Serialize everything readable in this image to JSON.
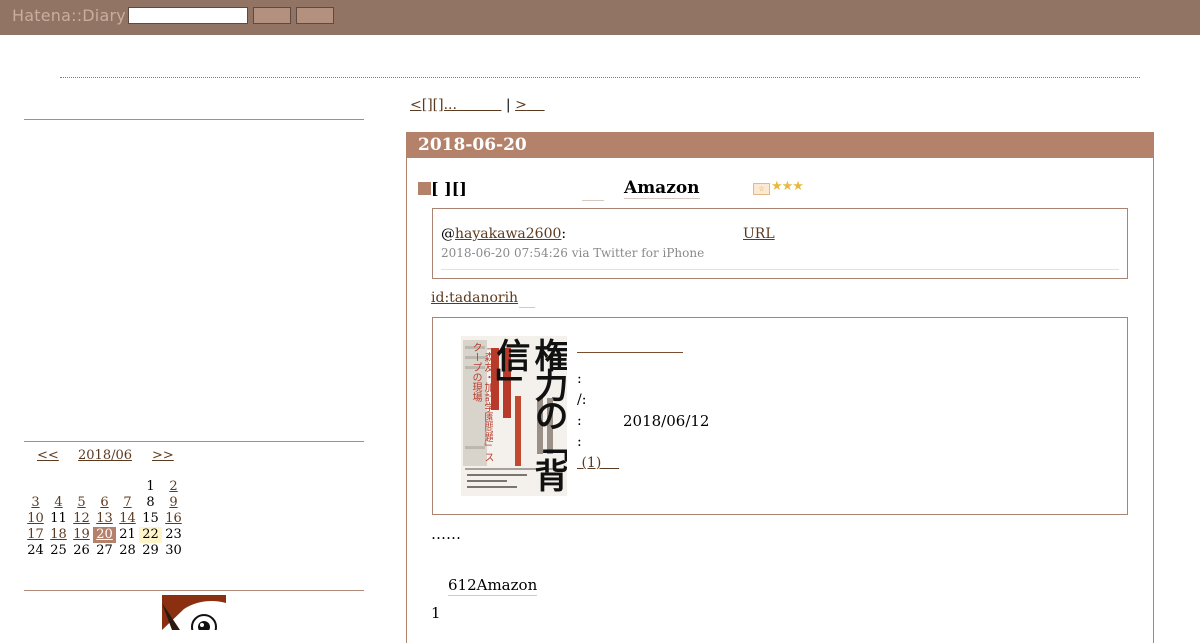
{
  "header": {
    "logo": "Hatena::Diary",
    "search_placeholder": "",
    "button1_label": "",
    "button2_label": ""
  },
  "pager": {
    "prev": "<[][]...",
    "separator": "|",
    "next": ">"
  },
  "calendar": {
    "prev": "<<",
    "month": "2018/06",
    "next": ">>",
    "weeks": [
      [
        {
          "d": ""
        },
        {
          "d": ""
        },
        {
          "d": ""
        },
        {
          "d": ""
        },
        {
          "d": ""
        },
        {
          "d": "1",
          "link": false
        },
        {
          "d": "2",
          "link": true
        }
      ],
      [
        {
          "d": "3",
          "link": true
        },
        {
          "d": "4",
          "link": true
        },
        {
          "d": "5",
          "link": true
        },
        {
          "d": "6",
          "link": true
        },
        {
          "d": "7",
          "link": true
        },
        {
          "d": "8",
          "link": false
        },
        {
          "d": "9",
          "link": true
        }
      ],
      [
        {
          "d": "10",
          "link": true
        },
        {
          "d": "11",
          "link": false
        },
        {
          "d": "12",
          "link": true
        },
        {
          "d": "13",
          "link": true
        },
        {
          "d": "14",
          "link": true
        },
        {
          "d": "15",
          "link": false
        },
        {
          "d": "16",
          "link": true
        }
      ],
      [
        {
          "d": "17",
          "link": true
        },
        {
          "d": "18",
          "link": true
        },
        {
          "d": "19",
          "link": true
        },
        {
          "d": "20",
          "link": true,
          "today": true
        },
        {
          "d": "21",
          "link": false
        },
        {
          "d": "22",
          "link": false,
          "highlight": true
        },
        {
          "d": "23",
          "link": false
        }
      ],
      [
        {
          "d": "24",
          "link": false
        },
        {
          "d": "25",
          "link": false
        },
        {
          "d": "26",
          "link": false
        },
        {
          "d": "27",
          "link": false
        },
        {
          "d": "28",
          "link": false
        },
        {
          "d": "29",
          "link": false
        },
        {
          "d": "30",
          "link": false
        }
      ]
    ]
  },
  "entry": {
    "date": "2018-06-20",
    "section_title": "[ ][]",
    "amazon_title": "Amazon",
    "tweet": {
      "at": "@",
      "handle": "hayakawa2600",
      "colon": ":",
      "url_label": "URL",
      "meta": "2018-06-20 07:54:26 via Twitter for iPhone"
    },
    "id_link": "id:tadanorih",
    "book": {
      "line1": ":",
      "line2": "/:",
      "line3": ":",
      "date": "2018/06/12",
      "line4": ":",
      "review_link": "(1)",
      "cover_title": "権力の「背信」",
      "cover_subtitle": "「森友・加計学園問題」スクープの現場"
    },
    "para1": "……",
    "para2": "612Amazon",
    "para3": "1"
  },
  "colors": {
    "topbar": "#927465",
    "accent": "#b4826a",
    "link": "#5c3a1f"
  }
}
